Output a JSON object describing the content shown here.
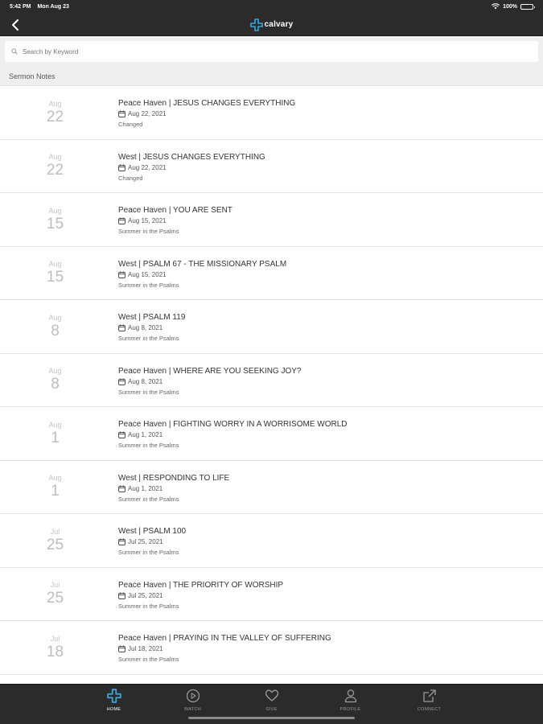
{
  "status": {
    "time": "5:42 PM",
    "date": "Mon Aug 23",
    "battery": "100%",
    "battery_level": 1.0
  },
  "nav": {
    "logo_text": "calvary"
  },
  "search": {
    "placeholder": "Search by Keyword"
  },
  "section": {
    "title": "Sermon Notes"
  },
  "sermons": [
    {
      "month": "Aug",
      "day": "22",
      "title": "Peace Haven | JESUS CHANGES EVERYTHING",
      "date": "Aug 22, 2021",
      "series": "Changed"
    },
    {
      "month": "Aug",
      "day": "22",
      "title": "West | JESUS CHANGES EVERYTHING",
      "date": "Aug 22, 2021",
      "series": "Changed"
    },
    {
      "month": "Aug",
      "day": "15",
      "title": "Peace Haven | YOU ARE SENT",
      "date": "Aug 15, 2021",
      "series": "Summer in the Psalms"
    },
    {
      "month": "Aug",
      "day": "15",
      "title": "West | PSALM 67 - THE MISSIONARY PSALM",
      "date": "Aug 15, 2021",
      "series": "Summer in the Psalms"
    },
    {
      "month": "Aug",
      "day": "8",
      "title": "West | PSALM 119",
      "date": "Aug 8, 2021",
      "series": "Summer in the Psalms"
    },
    {
      "month": "Aug",
      "day": "8",
      "title": "Peace Haven | WHERE ARE YOU SEEKING JOY?",
      "date": "Aug 8, 2021",
      "series": "Summer in the Psalms"
    },
    {
      "month": "Aug",
      "day": "1",
      "title": "Peace Haven | FIGHTING WORRY IN A WORRISOME WORLD",
      "date": "Aug 1, 2021",
      "series": "Summer in the Psalms"
    },
    {
      "month": "Aug",
      "day": "1",
      "title": "West | RESPONDING TO LIFE",
      "date": "Aug 1, 2021",
      "series": "Summer in the Psalms"
    },
    {
      "month": "Jul",
      "day": "25",
      "title": "West | PSALM 100",
      "date": "Jul 25, 2021",
      "series": "Summer in the Psalms"
    },
    {
      "month": "Jul",
      "day": "25",
      "title": "Peace Haven | THE PRIORITY OF WORSHIP",
      "date": "Jul 25, 2021",
      "series": "Summer in the Psalms"
    },
    {
      "month": "Jul",
      "day": "18",
      "title": "Peace Haven | PRAYING IN THE VALLEY OF SUFFERING",
      "date": "Jul 18, 2021",
      "series": "Summer in the Psalms"
    }
  ],
  "tabs": [
    {
      "label": "HOME",
      "icon": "cross-icon",
      "active": true
    },
    {
      "label": "WATCH",
      "icon": "play-circle-icon",
      "active": false
    },
    {
      "label": "GIVE",
      "icon": "heart-icon",
      "active": false
    },
    {
      "label": "PROFILE",
      "icon": "person-icon",
      "active": false
    },
    {
      "label": "CONNECT",
      "icon": "share-icon",
      "active": false
    }
  ],
  "colors": {
    "accent": "#3aa6dd",
    "bar": "#2b2b2b"
  }
}
